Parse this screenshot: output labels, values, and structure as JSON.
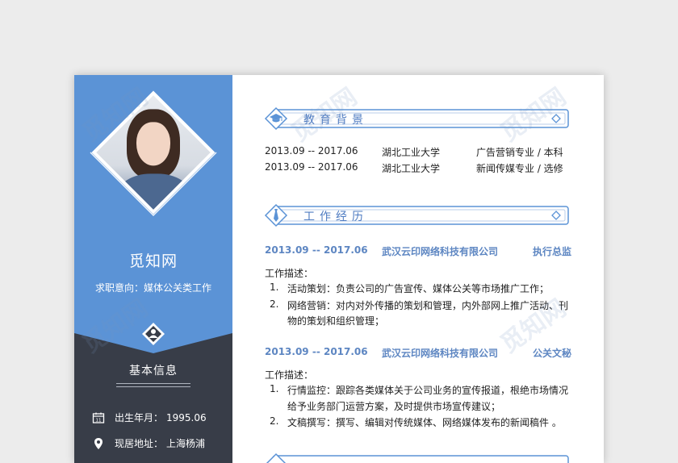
{
  "watermark_text": "觅知网",
  "profile": {
    "name": "觅知网",
    "intent_label": "求职意向：",
    "intent_value": "媒体公关类工作"
  },
  "basic_info": {
    "title": "基本信息",
    "items": [
      {
        "icon": "calendar-icon",
        "label": "出生年月：",
        "value": "1995.06"
      },
      {
        "icon": "location-pin-icon",
        "label": "现居地址：",
        "value": "上海杨浦"
      }
    ]
  },
  "education": {
    "title": "教育背景",
    "icon": "graduation-cap-icon",
    "rows": [
      {
        "period": "2013.09 -- 2017.06",
        "school": "湖北工业大学",
        "major": "广告营销专业 / 本科"
      },
      {
        "period": "2013.09 -- 2017.06",
        "school": "湖北工业大学",
        "major": "新闻传媒专业 / 选修"
      }
    ]
  },
  "work": {
    "title": "工作经历",
    "icon": "tie-icon",
    "jobs": [
      {
        "period": "2013.09 -- 2017.06",
        "company": "武汉云印网络科技有限公司",
        "position": "执行总监",
        "desc_label": "工作描述：",
        "items": [
          {
            "num": "1.",
            "lines": [
              "活动策划：负责公司的广告宣传、媒体公关等市场推广工作；"
            ]
          },
          {
            "num": "2.",
            "lines": [
              "网络营销：对内对外传播的策划和管理，内外部网上推广活动、刊",
              "物的策划和组织管理；"
            ]
          }
        ]
      },
      {
        "period": "2013.09 -- 2017.06",
        "company": "武汉云印网络科技有限公司",
        "position": "公关文秘",
        "desc_label": "工作描述：",
        "items": [
          {
            "num": "1.",
            "lines": [
              "行情监控：跟踪各类媒体关于公司业务的宣传报道，根绝市场情况",
              "给予业务部门运营方案，及时提供市场宣传建议；"
            ]
          },
          {
            "num": "2.",
            "lines": [
              "文稿撰写：撰写、编辑对传统媒体、网络媒体发布的新闻稿件 。"
            ]
          }
        ]
      }
    ]
  },
  "colors": {
    "accent": "#5b93d6",
    "dark": "#383d48",
    "title_blue": "#4f7cc2",
    "job_blue": "#5d86c2"
  }
}
